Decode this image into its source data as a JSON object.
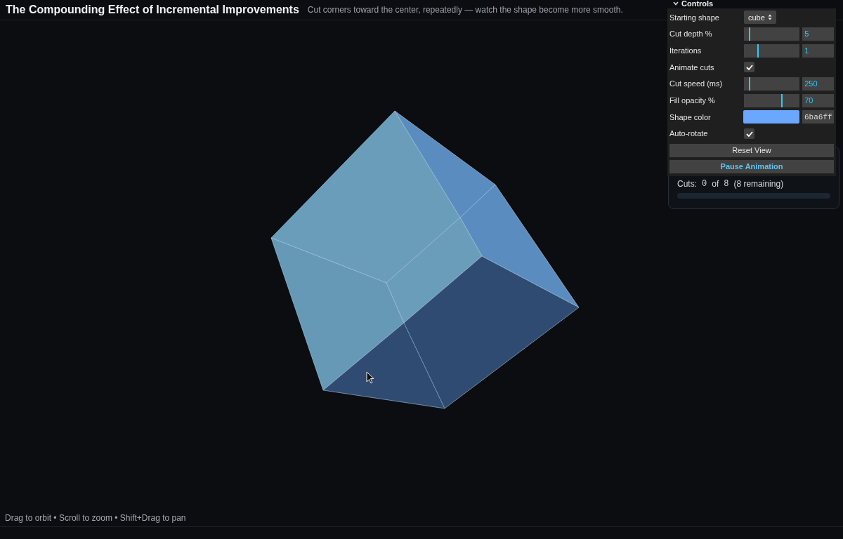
{
  "header": {
    "title": "The Compounding Effect of Incremental Improvements",
    "subtitle": "Cut corners toward the center, repeatedly — watch the shape become more smooth."
  },
  "controls": {
    "title": "Controls",
    "expanded": true,
    "rows": [
      {
        "kind": "select",
        "label": "Starting shape",
        "value": "cube"
      },
      {
        "kind": "slider",
        "label": "Cut depth %",
        "level": 0.1,
        "value": "5"
      },
      {
        "kind": "slider",
        "label": "Iterations",
        "level": 0.25,
        "value": "1"
      },
      {
        "kind": "checkbox",
        "label": "Animate cuts",
        "checked": true
      },
      {
        "kind": "slider",
        "label": "Cut speed (ms)",
        "level": 0.1,
        "value": "250"
      },
      {
        "kind": "slider",
        "label": "Fill opacity %",
        "level": 0.69,
        "value": "70"
      },
      {
        "kind": "color",
        "label": "Shape color",
        "value": "6ba6ff"
      },
      {
        "kind": "checkbox",
        "label": "Auto-rotate",
        "checked": true
      }
    ],
    "buttons": [
      {
        "label": "Reset View",
        "kind": "default"
      },
      {
        "label": "Pause Animation",
        "kind": "accent"
      }
    ]
  },
  "progress": {
    "label": "Cuts:",
    "done": "0",
    "of": "of",
    "total": "8",
    "remaining": "(8 remaining)",
    "level": 0
  },
  "hint": "Drag to orbit • Scroll to zoom • Shift+Drag to pan"
}
